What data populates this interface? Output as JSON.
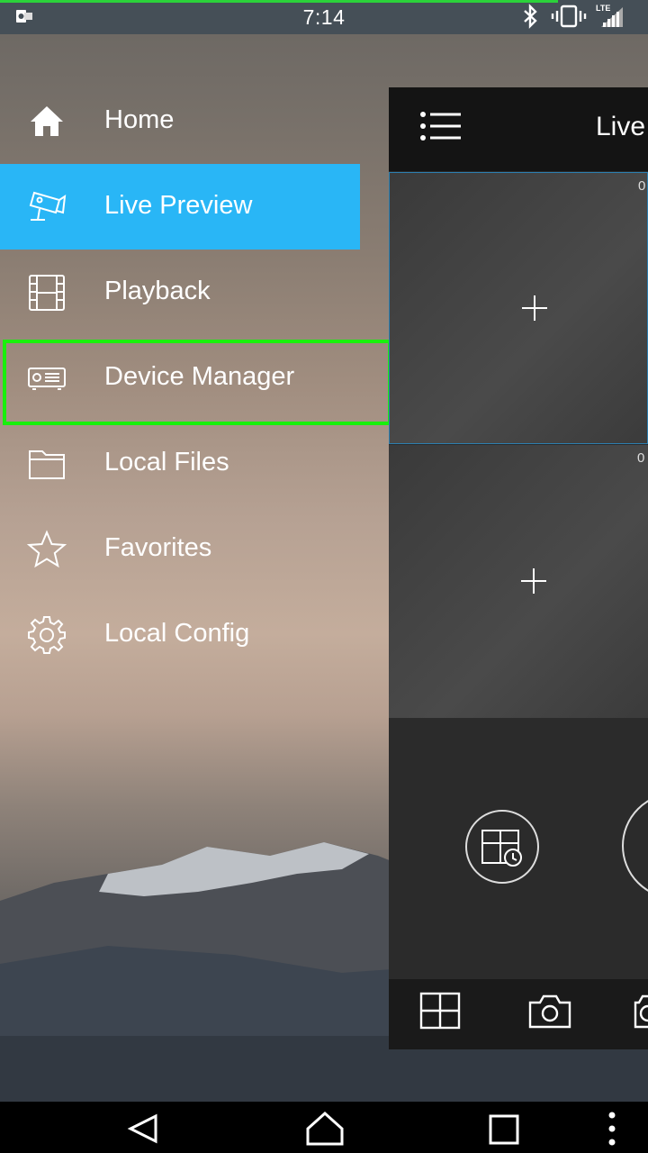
{
  "status_bar": {
    "time": "7:14",
    "network_label": "LTE",
    "icons": [
      "outlook-notification-icon",
      "bluetooth-icon",
      "vibrate-icon",
      "signal-icon"
    ]
  },
  "drawer": {
    "items": [
      {
        "label": "Home",
        "icon": "home-icon",
        "active": false
      },
      {
        "label": "Live Preview",
        "icon": "camera-icon",
        "active": true
      },
      {
        "label": "Playback",
        "icon": "film-icon",
        "active": false
      },
      {
        "label": "Device Manager",
        "icon": "device-icon",
        "active": false
      },
      {
        "label": "Local Files",
        "icon": "folder-icon",
        "active": false
      },
      {
        "label": "Favorites",
        "icon": "star-icon",
        "active": false
      },
      {
        "label": "Local Config",
        "icon": "gear-icon",
        "active": false
      }
    ],
    "active_color": "#29b6f6",
    "highlight_color": "#19f00c"
  },
  "panel": {
    "title": "Live",
    "cells": [
      {
        "number": "0"
      },
      {
        "number": "0"
      }
    ]
  },
  "navbar": {
    "buttons": [
      "back-icon",
      "home-icon",
      "recents-icon",
      "more-icon"
    ]
  }
}
